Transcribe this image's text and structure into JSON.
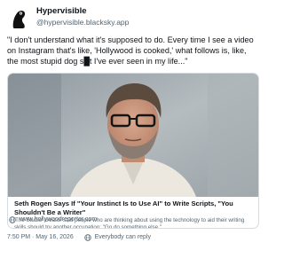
{
  "post": {
    "author": {
      "display_name": "Hypervisible",
      "handle": "@hypervisible.blacksky.app",
      "avatar_icon": "eye-silhouette-avatar"
    },
    "text": "\"I don't understand what it's supposed to do. Every time I see a video on Instagram that's like, 'Hollywood is cooked,' what follows is, like, the most stupid dog s█t I've ever seen in my life...\"",
    "embed": {
      "image_description": "Seth Rogen portrait",
      "title": "Seth Rogen Says If \"Your Instinct Is to Use AI\" to Write Scripts, \"You Shouldn't Be a Writer\"",
      "description": "'The Studio' creator said people who are thinking about using the technology to aid their writing skills should try another occupation: \"Go do something else.\"",
      "domain": "www.hollywoodreporter.com",
      "domain_icon": "globe-icon"
    },
    "timestamp": "7:50 PM · May 16, 2026",
    "separator": "·",
    "reply_setting": "Everybody can reply",
    "reply_icon": "globe-icon"
  },
  "colors": {
    "text_primary": "#0f1419",
    "text_secondary": "#536471",
    "border": "#d4dbe2",
    "background": "#ffffff"
  }
}
